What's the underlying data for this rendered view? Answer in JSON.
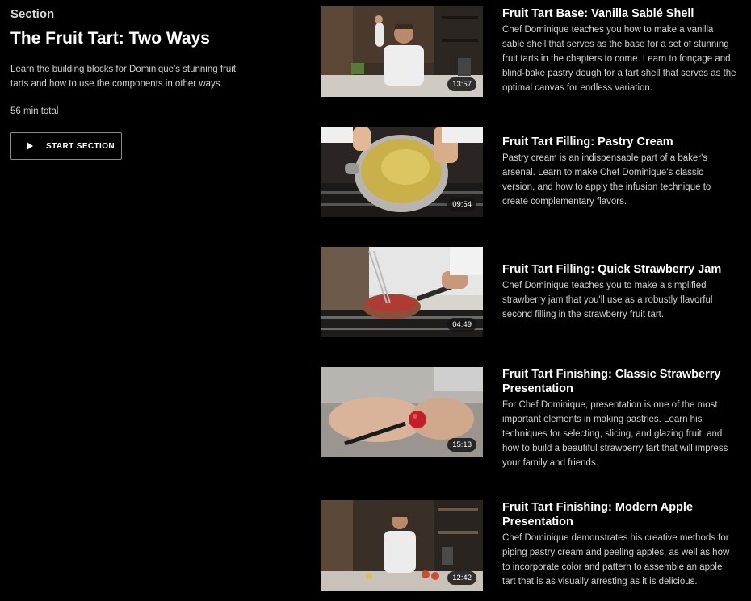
{
  "section": {
    "label": "Section",
    "title": "The Fruit Tart: Two Ways",
    "description": "Learn the building blocks for Dominique's stunning fruit tarts and how to use the components in other ways.",
    "total": "56 min total",
    "start_label": "START SECTION"
  },
  "lessons": [
    {
      "title": "Fruit Tart Base: Vanilla Sablé Shell",
      "description": "Chef Dominique teaches you how to make a vanilla sablé shell that serves as the base for a set of stunning fruit tarts in the chapters to come. Learn to fonçage and blind-bake pastry dough for a tart shell that serves as the optimal canvas for endless variation.",
      "duration": "13:57"
    },
    {
      "title": "Fruit Tart Filling: Pastry Cream",
      "description": "Pastry cream is an indispensable part of a baker's arsenal. Learn to make Chef Dominique's classic version, and how to apply the infusion technique to create complementary flavors.",
      "duration": "09:54"
    },
    {
      "title": "Fruit Tart Filling: Quick Strawberry Jam",
      "description": "Chef Dominique teaches you to make a simplified strawberry jam that you'll use as a robustly flavorful second filling in the strawberry fruit tart.",
      "duration": "04:49"
    },
    {
      "title": "Fruit Tart Finishing: Classic Strawberry Presentation",
      "description": "For Chef Dominique, presentation is one of the most important elements in making pastries. Learn his techniques for selecting, slicing, and glazing fruit, and how to build a beautiful strawberry tart that will impress your family and friends.",
      "duration": "15:13"
    },
    {
      "title": "Fruit Tart Finishing: Modern Apple Presentation",
      "description": "Chef Dominique demonstrates his creative methods for piping pastry cream and peeling apples, as well as how to incorporate color and pattern to assemble an apple tart that is as visually arresting as it is delicious.",
      "duration": "12:42"
    }
  ]
}
